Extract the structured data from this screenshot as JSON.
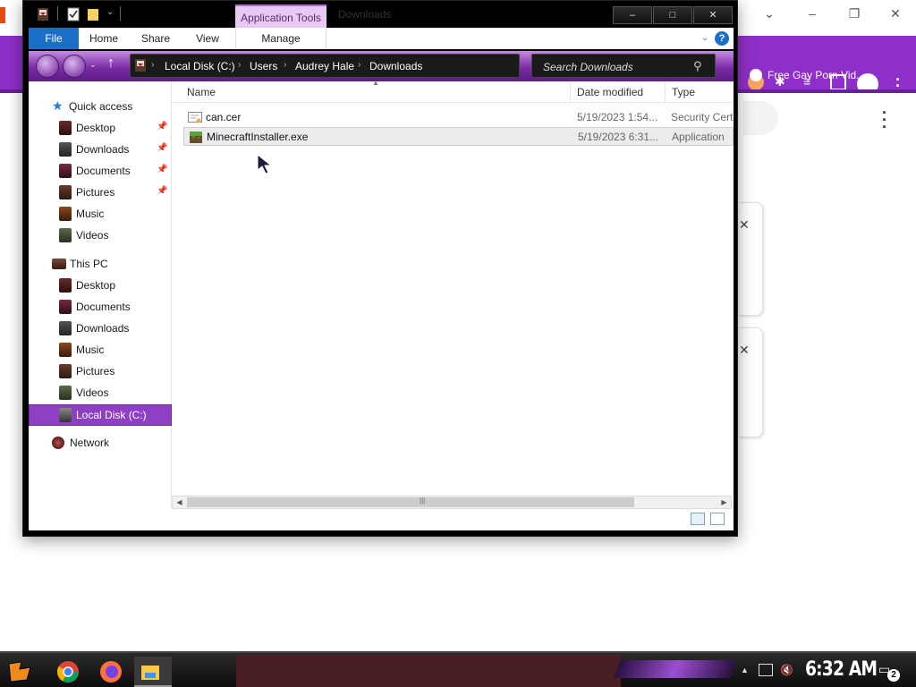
{
  "background_browser": {
    "bookmark_label": "Free Gay Porn Vid...",
    "accent_color": "#8e2fc9"
  },
  "window": {
    "title": "Downloads",
    "contextual_tab": "Application Tools",
    "controls": {
      "minimize": "–",
      "maximize": "□",
      "close": "✕"
    }
  },
  "ribbon": {
    "tabs": [
      "File",
      "Home",
      "Share",
      "View",
      "Manage"
    ],
    "help_label": "?"
  },
  "address_bar": {
    "path": [
      "Local Disk (C:)",
      "Users",
      "Audrey Hale",
      "Downloads"
    ]
  },
  "search": {
    "placeholder": "Search Downloads"
  },
  "nav_pane": {
    "quick_access": "Quick access",
    "quick_items": [
      {
        "label": "Desktop",
        "icon": "desktop-icon",
        "pinned": true
      },
      {
        "label": "Downloads",
        "icon": "downloads-icon",
        "pinned": true
      },
      {
        "label": "Documents",
        "icon": "documents-icon",
        "pinned": true
      },
      {
        "label": "Pictures",
        "icon": "pictures-icon",
        "pinned": true
      },
      {
        "label": "Music",
        "icon": "music-icon",
        "pinned": false
      },
      {
        "label": "Videos",
        "icon": "videos-icon",
        "pinned": false
      }
    ],
    "this_pc": "This PC",
    "pc_items": [
      {
        "label": "Desktop",
        "icon": "desktop-icon"
      },
      {
        "label": "Documents",
        "icon": "documents-icon"
      },
      {
        "label": "Downloads",
        "icon": "downloads-icon"
      },
      {
        "label": "Music",
        "icon": "music-icon"
      },
      {
        "label": "Pictures",
        "icon": "pictures-icon"
      },
      {
        "label": "Videos",
        "icon": "videos-icon"
      }
    ],
    "local_disk": "Local Disk (C:)",
    "network": "Network",
    "selected_color": "#8e3fc4"
  },
  "file_list": {
    "columns": [
      "Name",
      "Date modified",
      "Type"
    ],
    "files": [
      {
        "name": "can.cer",
        "date": "5/19/2023 1:54...",
        "type": "Security Certif",
        "icon": "certificate-icon"
      },
      {
        "name": "MinecraftInstaller.exe",
        "date": "5/19/2023 6:31...",
        "type": "Application",
        "icon": "minecraft-icon",
        "selected": true
      }
    ]
  },
  "taskbar": {
    "clock": "6:32 AM",
    "notification_count": "2"
  }
}
